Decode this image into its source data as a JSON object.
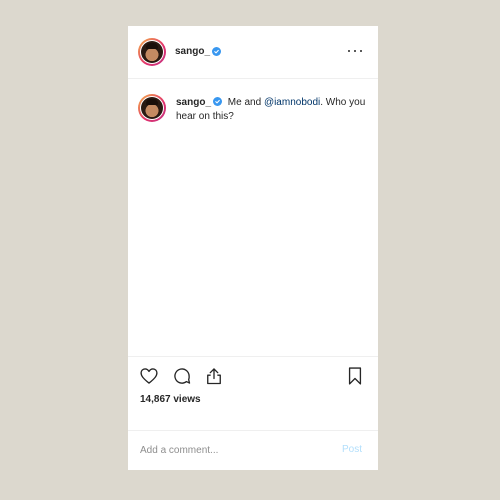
{
  "post": {
    "username": "sango_",
    "verified": true,
    "caption": {
      "username": "sango_",
      "text_before": " Me and ",
      "mention": "@iamnobodi",
      "text_after": ". Who you hear on this?"
    },
    "views": "14,867 views"
  },
  "comment": {
    "placeholder": "Add a comment...",
    "post_label": "Post"
  },
  "icons": {
    "more": "more-options-icon",
    "like": "heart-icon",
    "comment": "comment-icon",
    "share": "share-icon",
    "save": "bookmark-icon",
    "verified": "verified-badge-icon"
  },
  "colors": {
    "background": "#dcd8ce",
    "card": "#ffffff",
    "verified": "#3897f0",
    "mention": "#003569",
    "post_disabled": "#b2dffc"
  }
}
